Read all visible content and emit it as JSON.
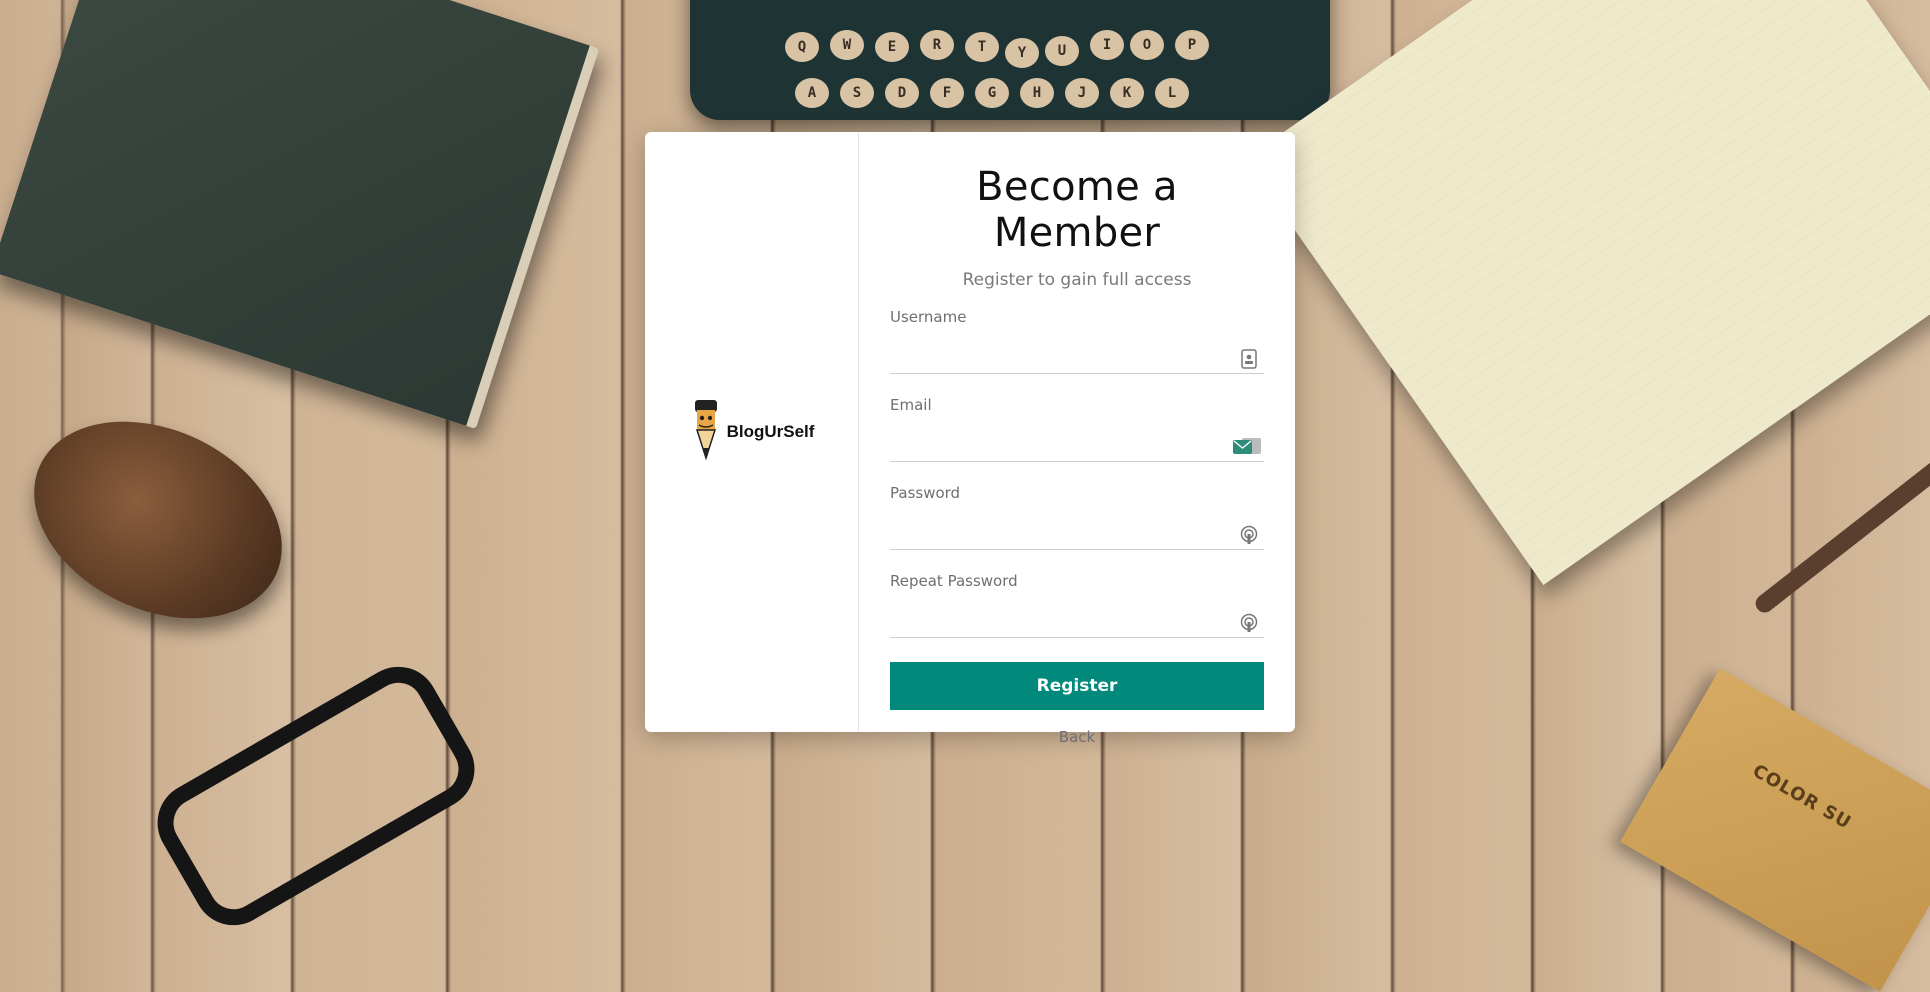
{
  "brand": {
    "name": "BlogUrSelf"
  },
  "form": {
    "title": "Become a Member",
    "subtitle": "Register to gain full access",
    "fields": [
      {
        "label": "Username",
        "value": "",
        "icon": "id-card-icon"
      },
      {
        "label": "Email",
        "value": "",
        "icon": "email-card-icon"
      },
      {
        "label": "Password",
        "value": "",
        "icon": "fingerprint-icon"
      },
      {
        "label": "Repeat Password",
        "value": "",
        "icon": "fingerprint-icon"
      }
    ],
    "register_label": "Register",
    "back_label": "Back"
  },
  "background": {
    "typewriter_keys_row1": [
      "Q",
      "W",
      "E",
      "R",
      "T",
      "Y",
      "U",
      "I",
      "O",
      "P"
    ],
    "typewriter_keys_row2": [
      "A",
      "S",
      "D",
      "F",
      "G",
      "H",
      "J",
      "K",
      "L"
    ],
    "colorbox_text": "COLOR SU"
  },
  "colors": {
    "accent": "#018a7b",
    "card": "#ffffff"
  }
}
